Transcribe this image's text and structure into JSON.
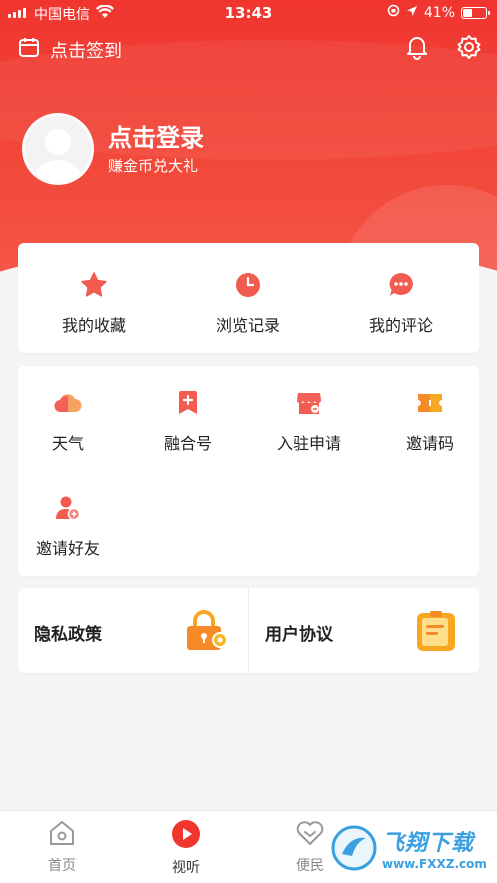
{
  "status_bar": {
    "carrier": "中国电信",
    "time": "13:43",
    "battery": "41%",
    "battery_level": 0.41
  },
  "top_bar": {
    "checkin_label": "点击签到",
    "icons": [
      "calendar-icon",
      "bell-icon",
      "gear-icon"
    ]
  },
  "profile": {
    "title": "点击登录",
    "subtitle": "赚金币兑大礼"
  },
  "quick_actions": [
    {
      "label": "我的收藏",
      "icon": "star-icon"
    },
    {
      "label": "浏览记录",
      "icon": "clock-icon"
    },
    {
      "label": "我的评论",
      "icon": "comment-icon"
    }
  ],
  "services": [
    {
      "label": "天气",
      "icon": "cloud-icon"
    },
    {
      "label": "融合号",
      "icon": "bookmark-plus-icon"
    },
    {
      "label": "入驻申请",
      "icon": "store-icon"
    },
    {
      "label": "邀请码",
      "icon": "ticket-icon"
    },
    {
      "label": "邀请好友",
      "icon": "add-user-icon"
    }
  ],
  "policies": [
    {
      "label": "隐私政策",
      "icon": "lock-gear-icon"
    },
    {
      "label": "用户协议",
      "icon": "notepad-icon"
    }
  ],
  "tab_bar": [
    {
      "label": "首页",
      "icon": "home-icon"
    },
    {
      "label": "视听",
      "icon": "play-icon",
      "active": true
    },
    {
      "label": "便民",
      "icon": "heart-icon"
    }
  ],
  "watermark": {
    "text": "飞翔下载",
    "url": "www.FXXZ.com"
  },
  "colors": {
    "brand_red": "#f0352f",
    "icon_red": "#f25b50",
    "icon_orange": "#f7a823",
    "background": "#f5f5f7"
  }
}
